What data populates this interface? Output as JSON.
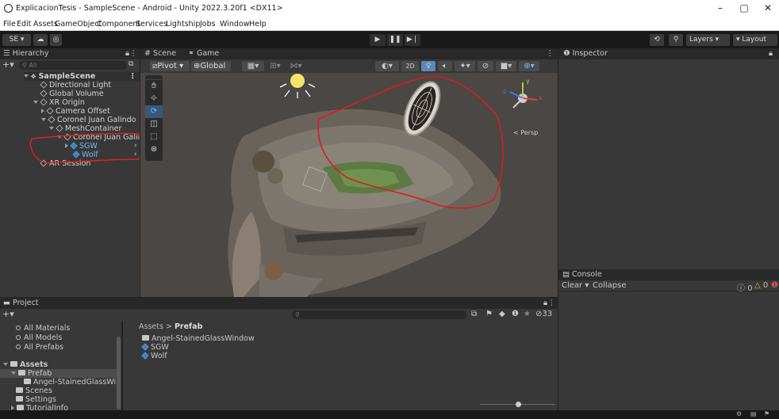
{
  "window": {
    "title": "ExplicacionTesis - SampleScene - Android - Unity 2022.3.20f1 <DX11>",
    "minimize": "–",
    "maximize": "▢",
    "close": "✕"
  },
  "menu": [
    "File",
    "Edit",
    "Assets",
    "GameObject",
    "Component",
    "Services",
    "Lightship",
    "Jobs",
    "Window",
    "Help"
  ],
  "toolbar": {
    "account": "SE ▾",
    "layers": "Layers",
    "layout": "Layout"
  },
  "hierarchy": {
    "tab": "Hierarchy",
    "search_placeholder": "All",
    "items": [
      {
        "label": "SampleScene"
      },
      {
        "label": "Directional Light"
      },
      {
        "label": "Global Volume"
      },
      {
        "label": "XR Origin"
      },
      {
        "label": "Camera Offset"
      },
      {
        "label": "Coronel Juan Galindo"
      },
      {
        "label": "MeshContainer"
      },
      {
        "label": "Coronel Juan Galind"
      },
      {
        "label": "SGW"
      },
      {
        "label": "Wolf"
      },
      {
        "label": "AR Session"
      }
    ]
  },
  "scene": {
    "tab_scene": "Scene",
    "tab_game": "Game",
    "pivot": "Pivot",
    "global": "Global",
    "mode_2d": "2D",
    "persp": "< Persp",
    "gizmo_y": "y",
    "gizmo_x": "x",
    "gizmo_z": "z"
  },
  "inspector": {
    "tab": "Inspector"
  },
  "console": {
    "tab": "Console",
    "clear": "Clear",
    "collapse": "Collapse",
    "info_count": "0",
    "warn_count": "0",
    "error_count": "0"
  },
  "project": {
    "tab": "Project",
    "hidden_count": "33",
    "favorites": [
      "All Materials",
      "All Models",
      "All Prefabs"
    ],
    "assets_label": "Assets",
    "tree": [
      "Prefab",
      "Angel-StainedGlassWir",
      "Scenes",
      "Settings",
      "TutorialInfo"
    ],
    "breadcrumb_root": "Assets",
    "breadcrumb_sep": ">",
    "breadcrumb_current": "Prefab",
    "files": [
      "Angel-StainedGlassWindow",
      "SGW",
      "Wolf"
    ]
  }
}
